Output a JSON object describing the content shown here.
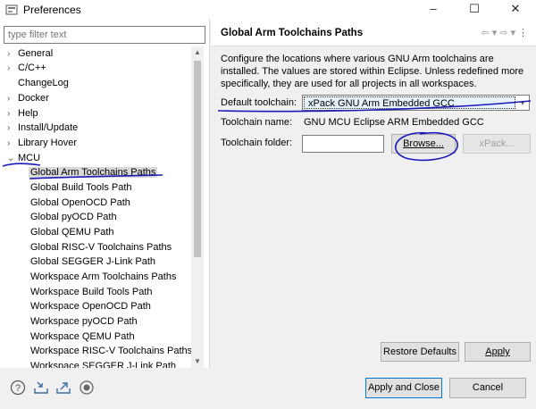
{
  "window": {
    "title": "Preferences",
    "controls": [
      "–",
      "☐",
      "✕"
    ]
  },
  "filter": {
    "placeholder": "type filter text"
  },
  "tree": {
    "items": [
      {
        "label": "General",
        "arrow": "›"
      },
      {
        "label": "C/C++",
        "arrow": "›"
      },
      {
        "label": "ChangeLog",
        "arrow": ""
      },
      {
        "label": "Docker",
        "arrow": "›"
      },
      {
        "label": "Help",
        "arrow": "›"
      },
      {
        "label": "Install/Update",
        "arrow": "›"
      },
      {
        "label": "Library Hover",
        "arrow": "›"
      },
      {
        "label": "MCU",
        "arrow": "⌄"
      },
      {
        "label": "Global Arm Toolchains Paths",
        "arrow": ""
      },
      {
        "label": "Global Build Tools Path",
        "arrow": ""
      },
      {
        "label": "Global OpenOCD Path",
        "arrow": ""
      },
      {
        "label": "Global pyOCD Path",
        "arrow": ""
      },
      {
        "label": "Global QEMU Path",
        "arrow": ""
      },
      {
        "label": "Global RISC-V Toolchains Paths",
        "arrow": ""
      },
      {
        "label": "Global SEGGER J-Link Path",
        "arrow": ""
      },
      {
        "label": "Workspace Arm Toolchains Paths",
        "arrow": ""
      },
      {
        "label": "Workspace Build Tools Path",
        "arrow": ""
      },
      {
        "label": "Workspace OpenOCD Path",
        "arrow": ""
      },
      {
        "label": "Workspace pyOCD Path",
        "arrow": ""
      },
      {
        "label": "Workspace QEMU Path",
        "arrow": ""
      },
      {
        "label": "Workspace RISC-V Toolchains Paths",
        "arrow": ""
      },
      {
        "label": "Workspace SEGGER J-Link Path",
        "arrow": ""
      }
    ],
    "selected": "Global Arm Toolchains Paths"
  },
  "page": {
    "heading": "Global Arm Toolchains Paths",
    "description": "Configure the locations where various GNU Arm toolchains are installed. The values are stored within Eclipse. Unless redefined more specifically, they are used for all projects in all workspaces.",
    "default_toolchain_label": "Default toolchain:",
    "default_toolchain_value": "xPack GNU Arm Embedded GCC",
    "toolchain_name_label": "Toolchain name:",
    "toolchain_name_value": "GNU MCU Eclipse ARM Embedded GCC",
    "toolchain_folder_label": "Toolchain folder:",
    "toolchain_folder_value": "",
    "browse_label": "Browse...",
    "xpack_label": "xPack...",
    "restore_defaults_label": "Restore Defaults",
    "apply_label": "Apply"
  },
  "footer": {
    "apply_close_label": "Apply and Close",
    "cancel_label": "Cancel"
  },
  "icons": [
    "help-icon",
    "import-icon",
    "export-icon",
    "record-icon"
  ],
  "colors": {
    "annotation_pen": "#1a1ab8",
    "selection": "#d9d9d9",
    "default_button_border": "#0078d7"
  }
}
